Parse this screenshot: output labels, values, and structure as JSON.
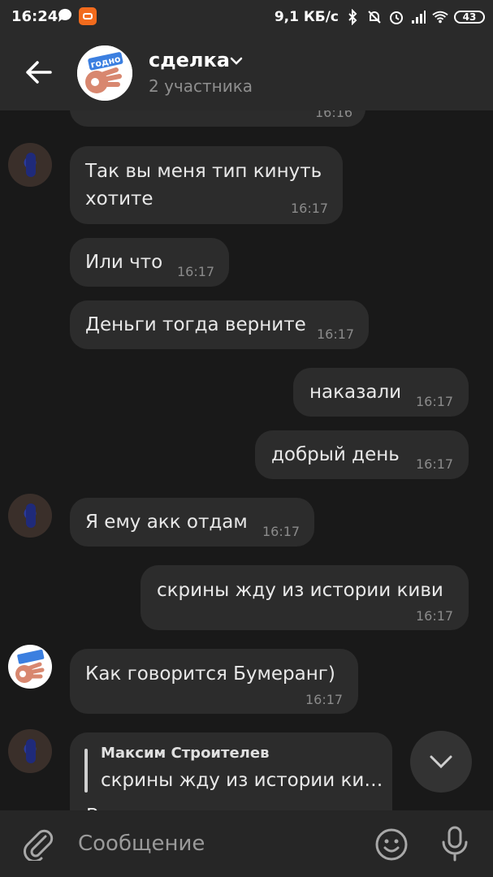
{
  "status_bar": {
    "time": "16:24",
    "network_speed": "9,1 КБ/с",
    "battery": "43"
  },
  "header": {
    "title": "сделка",
    "subtitle": "2 участника",
    "avatar_text": "годно"
  },
  "messages": [
    {
      "time": "16:16"
    },
    {
      "text": "Так вы меня тип кинуть хотите",
      "line1": "Так вы меня тип кинуть",
      "line2": "хотите",
      "time": "16:17"
    },
    {
      "text": "Или что",
      "time": "16:17"
    },
    {
      "text": "Деньги тогда верните",
      "time": "16:17"
    },
    {
      "text": "наказали",
      "time": "16:17"
    },
    {
      "text": "добрый день",
      "time": "16:17"
    },
    {
      "text": "Я ему акк отдам",
      "time": "16:17"
    },
    {
      "text": "скрины жду из истории киви",
      "time": "16:17"
    },
    {
      "text": "Как говорится Бумеранг)",
      "time": "16:17"
    },
    {
      "reply_author": "Максим Строителев",
      "reply_text": "скрины жду из истории ки…",
      "text_cut": "В"
    }
  ],
  "input": {
    "placeholder": "Сообщение"
  },
  "colors": {
    "background": "#191919",
    "bubble": "#2c2c2c",
    "header": "#2a2a2a",
    "accent_app": "#f26b1d"
  }
}
